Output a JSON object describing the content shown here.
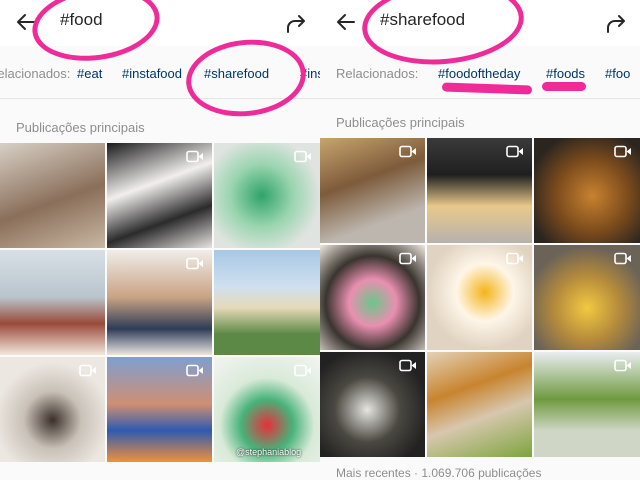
{
  "left": {
    "title": "#food",
    "related_label": "Relacionados:",
    "related_tags": [
      "#eat",
      "#instafood",
      "#sharefood",
      "#insta"
    ],
    "section_title": "Publicações principais",
    "tiles": [
      {
        "video": false,
        "bg": "linear-gradient(160deg,#d8d0c6,#8a6f5a 55%,#c9b7a3)"
      },
      {
        "video": true,
        "bg": "linear-gradient(160deg,#1a1a1a,#f2eeee 40%,#2b2b2b 70%,#e8e3e3)"
      },
      {
        "video": true,
        "bg": "radial-gradient(circle at 45% 50%,#2fa36a,#9ad5b0 40%,#dfe4e0 75%)"
      },
      {
        "video": false,
        "bg": "linear-gradient(180deg,#d8e0e6 0%,#b9c4cc 45%,#9a4a3a 70%,#f3e7dc)"
      },
      {
        "video": true,
        "bg": "linear-gradient(180deg,#f0ede9,#c9a384 45%,#2f3c57 75%,#eae6e1)"
      },
      {
        "video": false,
        "bg": "linear-gradient(180deg,#a8c7e5 0%,#cfe0ef 35%,#e6d9b8 55%,#5c8a46 80%)"
      },
      {
        "video": true,
        "bg": "radial-gradient(circle at 50% 60%,#3a2f2a,#c9c1b8 35%,#ece7e1 70%)"
      },
      {
        "video": true,
        "bg": "linear-gradient(180deg,#7e9fd1,#cf8f73 45%,#2e5ab0 70%,#f0913a)"
      },
      {
        "video": true,
        "bg": "radial-gradient(circle at 50% 65%,#e7303a,#48b27a 30%,#d9ead8 55%,#f4f4f4)"
      }
    ],
    "watermark": "@stephaniablog"
  },
  "right": {
    "title": "#sharefood",
    "related_label": "Relacionados:",
    "related_tags": [
      "#foodoftheday",
      "#foods",
      "#foo"
    ],
    "section_title": "Publicações principais",
    "tiles": [
      {
        "video": true,
        "bg": "linear-gradient(160deg,#c9a46e,#7d5b3b 40%,#bdb6ae 75%)"
      },
      {
        "video": true,
        "bg": "linear-gradient(180deg,#3a3a3a,#1f1f1f 35%,#e9c98a 65%,#b7b2ac)"
      },
      {
        "video": true,
        "bg": "radial-gradient(circle at 55% 55%,#c88230,#7a4a1c 45%,#2b2520 80%)"
      },
      {
        "video": true,
        "bg": "radial-gradient(circle at 50% 55%,#6cc58a,#e98fb0 30%,#3a342f 60%,#efe8df)"
      },
      {
        "video": true,
        "bg": "radial-gradient(circle at 55% 45%,#f4b41a,#fff6e8 35%,#e0d3c1 70%)"
      },
      {
        "video": true,
        "bg": "radial-gradient(circle at 50% 60%,#f2c940,#b48a3c 40%,#6b6258 75%)"
      },
      {
        "video": true,
        "bg": "radial-gradient(circle at 45% 55%,#e7e5e0,#4b4842 40%,#222 75%)"
      },
      {
        "video": false,
        "bg": "linear-gradient(160deg,#e3d2b6,#c8842f 35%,#d7c7ae 60%,#7da53e)"
      },
      {
        "video": true,
        "bg": "linear-gradient(180deg,#e9edf0,#6f9a3f 45%,#cfd6c5 75%)"
      }
    ],
    "footer_text": "Mais recentes · 1.069.706 publicações"
  },
  "colors": {
    "accent_annotation": "#ef2b99",
    "tag_link": "#003569",
    "muted_text": "#8e8e8e"
  },
  "icons": [
    "back-arrow-icon",
    "share-arrow-icon",
    "video-camera-icon"
  ]
}
